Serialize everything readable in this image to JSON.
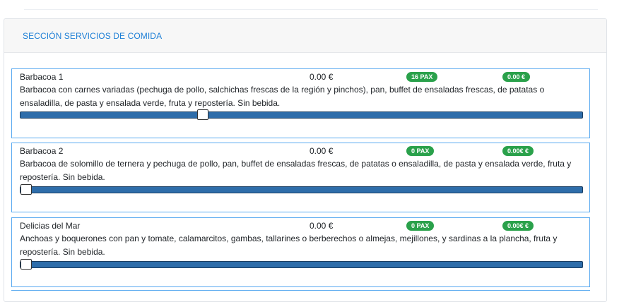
{
  "section": {
    "title": "SECCIÓN SERVICIOS DE COMIDA"
  },
  "items": [
    {
      "name": "Barbacoa 1",
      "price": "0.00 €",
      "pax_badge": "16 PAX",
      "total_badge": "0.00 €",
      "description": "Barbacoa con carnes variadas (pechuga de pollo, salchichas frescas de la región y pinchos), pan, buffet de ensaladas frescas, de patatas o ensaladilla, de pasta y ensalada verde, fruta y repostería. Sin bebida.",
      "slider_fraction": 0.325
    },
    {
      "name": "Barbacoa 2",
      "price": "0.00 €",
      "pax_badge": "0 PAX",
      "total_badge": "0.00€ €",
      "description": "Barbacoa de solomillo de ternera y pechuga de pollo, pan, buffet de ensaladas frescas, de patatas o ensaladilla, de pasta y ensalada verde, fruta y repostería. Sin bebida.",
      "slider_fraction": 0
    },
    {
      "name": "Delicias del Mar",
      "price": "0.00 €",
      "pax_badge": "0 PAX",
      "total_badge": "0.00€ €",
      "description": "Anchoas y boquerones con pan y tomate, calamarcitos, gambas, tallarines o berberechos o almejas, mejillones, y sardinas a la plancha, fruta y repostería. Sin bebida.",
      "slider_fraction": 0
    }
  ],
  "colors": {
    "accent": "#1e7fd6",
    "badge": "#2aa14b",
    "slider_track": "#2e6daa",
    "item_border": "#5aaaf0"
  }
}
